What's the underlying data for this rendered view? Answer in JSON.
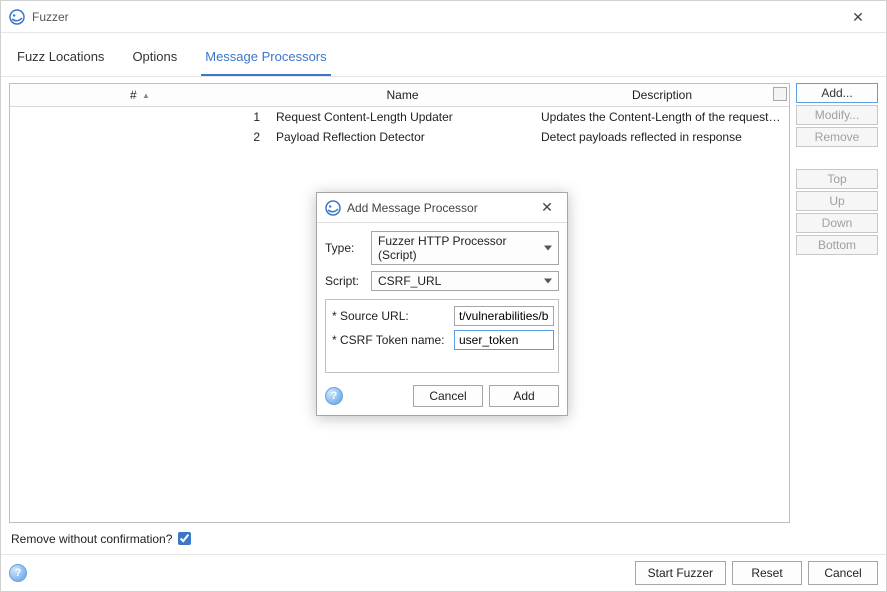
{
  "window": {
    "title": "Fuzzer"
  },
  "tabs": {
    "fuzz_locations": "Fuzz Locations",
    "options": "Options",
    "message_processors": "Message Processors"
  },
  "columns": {
    "num": "#",
    "name": "Name",
    "description": "Description"
  },
  "rows": [
    {
      "num": "1",
      "name": "Request Content-Length Updater",
      "description": "Updates the Content-Length of the request h..."
    },
    {
      "num": "2",
      "name": "Payload Reflection Detector",
      "description": "Detect payloads reflected in response"
    }
  ],
  "side": {
    "add": "Add...",
    "modify": "Modify...",
    "remove": "Remove",
    "top": "Top",
    "up": "Up",
    "down": "Down",
    "bottom": "Bottom"
  },
  "footer": {
    "remove_confirm_label": "Remove without confirmation?"
  },
  "bottom": {
    "start": "Start Fuzzer",
    "reset": "Reset",
    "cancel": "Cancel"
  },
  "dialog": {
    "title": "Add Message Processor",
    "type_label": "Type:",
    "type_value": "Fuzzer HTTP Processor (Script)",
    "script_label": "Script:",
    "script_value": "CSRF_URL",
    "param_source_label": "* Source URL:",
    "param_source_value": "t/vulnerabilities/brute",
    "param_token_label": "* CSRF Token name:",
    "param_token_value": "user_token",
    "cancel": "Cancel",
    "add": "Add"
  }
}
